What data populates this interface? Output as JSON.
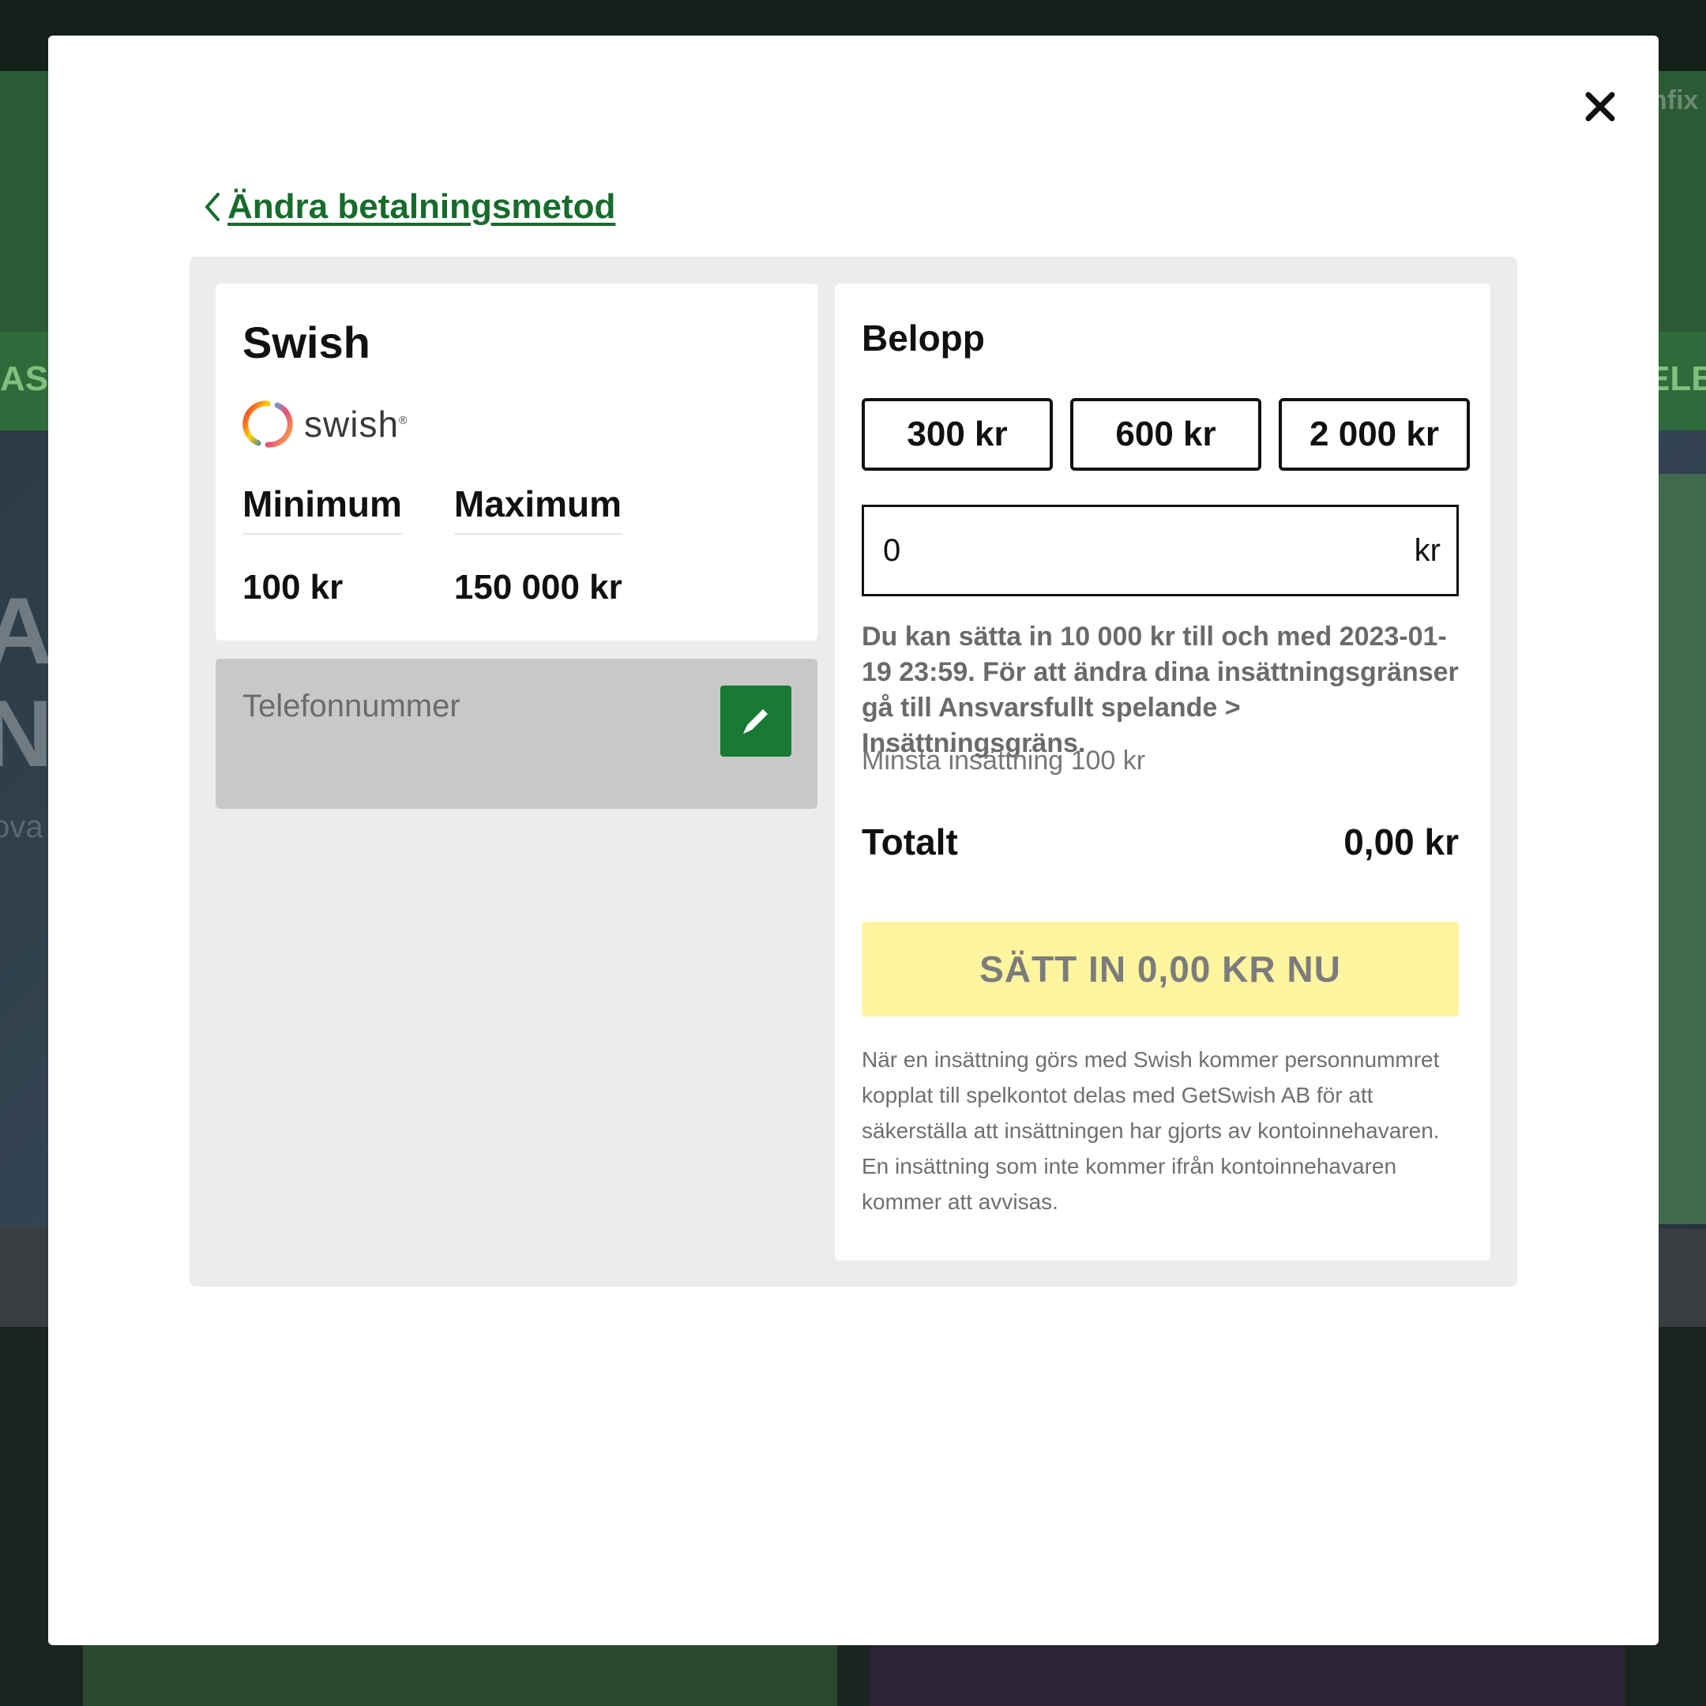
{
  "background": {
    "nav_left": "ASIN",
    "nav_right": "ELB",
    "header_right": "hfix",
    "hero_line1": "AL",
    "hero_line2": "N",
    "hero_line3": "ova"
  },
  "modal": {
    "close_icon": "close-icon",
    "back_label": "Ändra betalningsmetod"
  },
  "method": {
    "title": "Swish",
    "logo_text": "swish",
    "logo_mark": "®",
    "min_label": "Minimum",
    "max_label": "Maximum",
    "min_value": "100 kr",
    "max_value": "150 000 kr",
    "phone_label": "Telefonnummer",
    "edit_icon": "pencil-icon"
  },
  "amount": {
    "title": "Belopp",
    "quick": [
      "300 kr",
      "600 kr",
      "2 000 kr"
    ],
    "input_value": "0",
    "unit": "kr",
    "limit_info": "Du kan sätta in 10 000 kr till och med 2023-01-19 23:59. För att ändra dina insättningsgränser gå till Ansvarsfullt spelande > Insättningsgräns.",
    "min_deposit": "Minsta insättning 100 kr",
    "total_label": "Totalt",
    "total_value": "0,00 kr",
    "deposit_button": "SÄTT IN 0,00 KR NU",
    "disclaimer": "När en insättning görs med Swish kommer personnummret kopplat till spelkontot delas med GetSwish AB för att säkerställa att insättningen har gjorts av kontoinnehavaren. En insättning som inte kommer ifrån kontoinnehavaren kommer att avvisas."
  },
  "colors": {
    "brand_green": "#187a35",
    "link_green": "#176b2c",
    "deposit_button_bg": "#fff5a0",
    "panel_bg": "#ececec",
    "phone_box_bg": "#c8c8c8"
  }
}
